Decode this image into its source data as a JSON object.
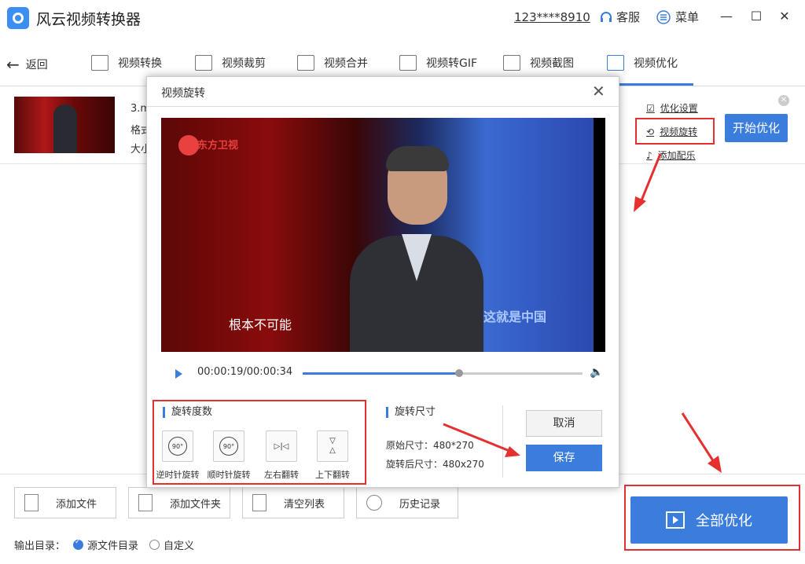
{
  "app": {
    "title": "风云视频转换器",
    "account": "123****8910",
    "service": "客服",
    "menu": "菜单",
    "min": "—",
    "max": "☐",
    "close": "✕"
  },
  "nav": {
    "back": "返回",
    "tabs": [
      "视频转换",
      "视频裁剪",
      "视频合并",
      "视频转GIF",
      "视频截图",
      "视频优化"
    ],
    "active_tab": 5
  },
  "file": {
    "name": "3.m",
    "format_label": "格式",
    "size_label": "大小"
  },
  "options": {
    "optimize_settings": "优化设置",
    "video_rotate": "视频旋转",
    "add_music": "添加配乐"
  },
  "start_button": "开始优化",
  "dialog": {
    "title": "视频旋转",
    "video": {
      "logo": "东方卫视",
      "subtitle": "根本不可能",
      "tag": "这就是中国"
    },
    "player": {
      "time": "00:00:19/00:00:34",
      "progress": 0.56
    },
    "rotation_degree": {
      "title": "旋转度数",
      "buttons": [
        {
          "icon_text": "90°",
          "label": "逆时针旋转"
        },
        {
          "icon_text": "90°",
          "label": "顺时针旋转"
        },
        {
          "icon_text": "▷|◁",
          "label": "左右翻转"
        },
        {
          "icon_text": "▽\n△",
          "label": "上下翻转"
        }
      ]
    },
    "rotation_size": {
      "title": "旋转尺寸",
      "original": "原始尺寸：480*270",
      "rotated": "旋转后尺寸：480x270"
    },
    "cancel": "取消",
    "save": "保存"
  },
  "bottom": {
    "buttons": [
      "添加文件",
      "添加文件夹",
      "清空列表",
      "历史记录"
    ],
    "output_label": "输出目录：",
    "output_source": "源文件目录",
    "output_custom": "自定义",
    "all_optimize": "全部优化"
  },
  "colors": {
    "accent": "#3b7ddd",
    "highlight": "#e53030"
  }
}
